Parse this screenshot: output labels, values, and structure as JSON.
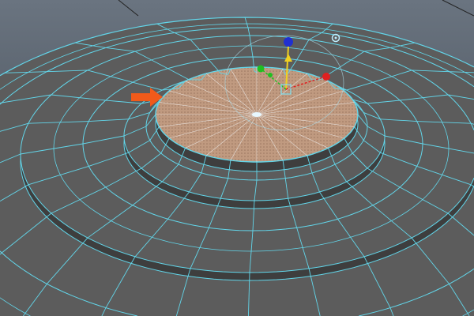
{
  "viewport": {
    "background_top": "#6a7480",
    "background_bottom": "#3a4048",
    "mesh_fill": "#5c5c5c",
    "mesh_side": "#3e3e3e",
    "wire_color": "#62d6ea",
    "selected_face_color": "#c09a80",
    "spokes": 24
  },
  "gizmo": {
    "icons": [
      "move-manipulator-icon",
      "pivot-circle-icon"
    ],
    "x_color": "#e02020",
    "y_color": "#f0d020",
    "z_color": "#2030d0",
    "xy_color": "#20c020"
  },
  "annotation": {
    "icon": "orange-arrow-icon",
    "color": "#f05a1a"
  }
}
